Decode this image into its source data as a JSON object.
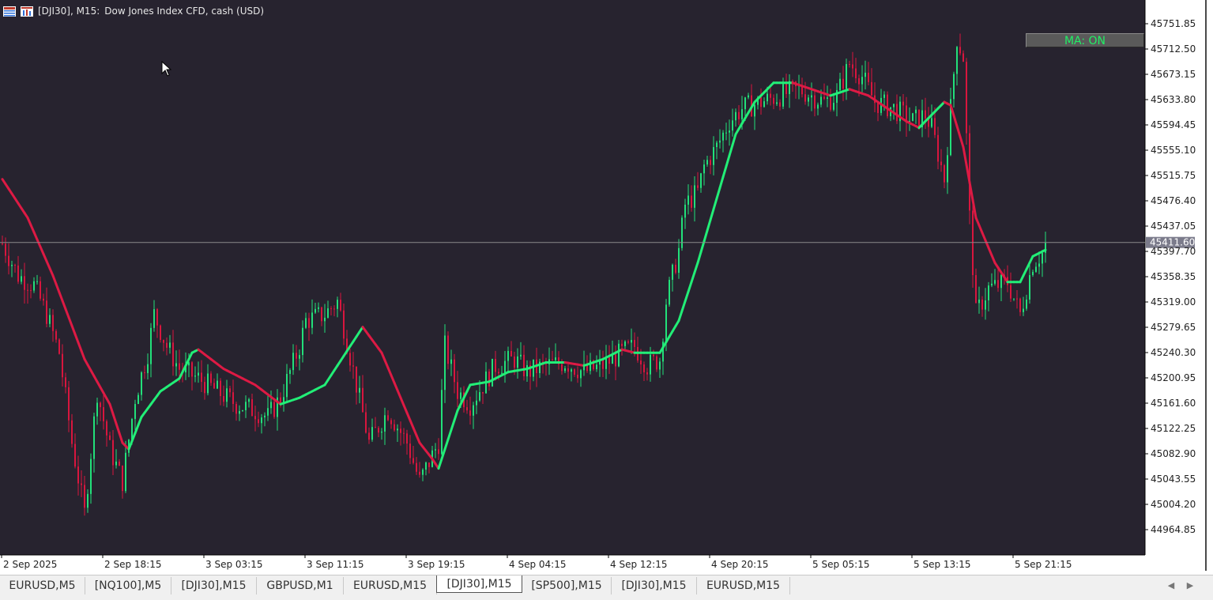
{
  "title": {
    "symbol": "[DJI30], M15:",
    "description": "Dow Jones Index CFD, cash (USD)"
  },
  "ma_button": {
    "label": "MA: ON"
  },
  "colors": {
    "background": "#27232f",
    "bull": "#22e07a",
    "bear": "#d8163e",
    "ma_up": "#22ee77",
    "ma_down": "#dd1a44",
    "price_line": "#8a8a8a",
    "price_badge": "#7b7b8b"
  },
  "tabs": [
    {
      "label": "EURUSD,M5",
      "active": false
    },
    {
      "label": "[NQ100],M5",
      "active": false
    },
    {
      "label": "[DJI30],M15",
      "active": false
    },
    {
      "label": "GBPUSD,M1",
      "active": false
    },
    {
      "label": "EURUSD,M15",
      "active": false
    },
    {
      "label": "[DJI30],M15",
      "active": true
    },
    {
      "label": "[SP500],M15",
      "active": false
    },
    {
      "label": "[DJI30],M15",
      "active": false
    },
    {
      "label": "EURUSD,M15",
      "active": false
    }
  ],
  "nav": {
    "prev_icon": "chevron-left-icon",
    "next_icon": "chevron-right-icon"
  },
  "chart_data": {
    "type": "candlestick",
    "symbol": "[DJI30]",
    "timeframe": "M15",
    "ylim": [
      44930,
      45780
    ],
    "y_ticks": [
      45751.85,
      45712.5,
      45673.15,
      45633.8,
      45594.45,
      45555.1,
      45515.75,
      45476.4,
      45437.05,
      45397.7,
      45358.35,
      45319.0,
      45279.65,
      45240.3,
      45200.95,
      45161.6,
      45122.25,
      45082.9,
      45043.55,
      45004.2,
      44964.85
    ],
    "y_tick_labels": [
      "45751.85",
      "45712.50",
      "45673.15",
      "45633.80",
      "45594.45",
      "45555.10",
      "45515.75",
      "45476.40",
      "45437.05",
      "45397.70",
      "45358.35",
      "45319.00",
      "45279.65",
      "45240.30",
      "45200.95",
      "45161.60",
      "45122.25",
      "45082.90",
      "45043.55",
      "45004.20",
      "44964.85"
    ],
    "x_tick_labels": [
      "2 Sep 2025",
      "2 Sep 18:15",
      "3 Sep 03:15",
      "3 Sep 11:15",
      "3 Sep 19:15",
      "4 Sep 04:15",
      "4 Sep 12:15",
      "4 Sep 20:15",
      "5 Sep 05:15",
      "5 Sep 13:15",
      "5 Sep 21:15"
    ],
    "current_price": 45411.6,
    "current_price_label": "45411.60",
    "bars_per_x_tick": 32,
    "price_path": [
      [
        0,
        45410
      ],
      [
        5,
        45360
      ],
      [
        10,
        45345
      ],
      [
        14,
        45300
      ],
      [
        18,
        45240
      ],
      [
        22,
        45100
      ],
      [
        26,
        44990
      ],
      [
        30,
        45180
      ],
      [
        34,
        45090
      ],
      [
        38,
        45040
      ],
      [
        42,
        45170
      ],
      [
        46,
        45240
      ],
      [
        48,
        45300
      ],
      [
        52,
        45250
      ],
      [
        56,
        45215
      ],
      [
        62,
        45200
      ],
      [
        68,
        45180
      ],
      [
        74,
        45160
      ],
      [
        80,
        45150
      ],
      [
        84,
        45140
      ],
      [
        88,
        45170
      ],
      [
        94,
        45250
      ],
      [
        96,
        45290
      ],
      [
        102,
        45300
      ],
      [
        106,
        45320
      ],
      [
        108,
        45280
      ],
      [
        112,
        45190
      ],
      [
        116,
        45100
      ],
      [
        122,
        45150
      ],
      [
        128,
        45100
      ],
      [
        132,
        45040
      ],
      [
        134,
        45060
      ],
      [
        138,
        45100
      ],
      [
        140,
        45250
      ],
      [
        144,
        45180
      ],
      [
        148,
        45160
      ],
      [
        152,
        45190
      ],
      [
        156,
        45220
      ],
      [
        162,
        45230
      ],
      [
        166,
        45210
      ],
      [
        172,
        45220
      ],
      [
        178,
        45225
      ],
      [
        184,
        45210
      ],
      [
        190,
        45220
      ],
      [
        196,
        45240
      ],
      [
        200,
        45250
      ],
      [
        204,
        45220
      ],
      [
        208,
        45230
      ],
      [
        210,
        45320
      ],
      [
        214,
        45400
      ],
      [
        216,
        45470
      ],
      [
        220,
        45490
      ],
      [
        222,
        45530
      ],
      [
        226,
        45560
      ],
      [
        230,
        45600
      ],
      [
        234,
        45620
      ],
      [
        240,
        45630
      ],
      [
        246,
        45640
      ],
      [
        252,
        45650
      ],
      [
        256,
        45640
      ],
      [
        260,
        45630
      ],
      [
        264,
        45640
      ],
      [
        268,
        45690
      ],
      [
        272,
        45670
      ],
      [
        276,
        45630
      ],
      [
        282,
        45620
      ],
      [
        288,
        45600
      ],
      [
        292,
        45610
      ],
      [
        294,
        45590
      ],
      [
        298,
        45510
      ],
      [
        300,
        45620
      ],
      [
        302,
        45730
      ],
      [
        304,
        45700
      ],
      [
        306,
        45450
      ],
      [
        308,
        45300
      ],
      [
        312,
        45340
      ],
      [
        318,
        45350
      ],
      [
        322,
        45300
      ],
      [
        326,
        45380
      ],
      [
        330,
        45400
      ]
    ],
    "ma_path": [
      [
        0,
        45510
      ],
      [
        8,
        45450
      ],
      [
        16,
        45360
      ],
      [
        26,
        45230
      ],
      [
        34,
        45160
      ],
      [
        38,
        45100
      ],
      [
        40,
        45090
      ],
      [
        44,
        45140
      ],
      [
        50,
        45180
      ],
      [
        56,
        45200
      ],
      [
        60,
        45240
      ],
      [
        62,
        45245
      ],
      [
        70,
        45215
      ],
      [
        80,
        45190
      ],
      [
        88,
        45160
      ],
      [
        94,
        45170
      ],
      [
        102,
        45190
      ],
      [
        110,
        45250
      ],
      [
        114,
        45280
      ],
      [
        120,
        45240
      ],
      [
        126,
        45170
      ],
      [
        132,
        45100
      ],
      [
        136,
        45075
      ],
      [
        138,
        45060
      ],
      [
        144,
        45150
      ],
      [
        148,
        45190
      ],
      [
        154,
        45195
      ],
      [
        160,
        45210
      ],
      [
        166,
        45215
      ],
      [
        172,
        45225
      ],
      [
        178,
        45225
      ],
      [
        184,
        45220
      ],
      [
        190,
        45230
      ],
      [
        196,
        45245
      ],
      [
        200,
        45240
      ],
      [
        208,
        45240
      ],
      [
        214,
        45290
      ],
      [
        220,
        45380
      ],
      [
        226,
        45480
      ],
      [
        232,
        45580
      ],
      [
        238,
        45630
      ],
      [
        244,
        45660
      ],
      [
        250,
        45660
      ],
      [
        256,
        45650
      ],
      [
        262,
        45640
      ],
      [
        268,
        45650
      ],
      [
        274,
        45640
      ],
      [
        280,
        45620
      ],
      [
        286,
        45600
      ],
      [
        290,
        45590
      ],
      [
        294,
        45610
      ],
      [
        298,
        45630
      ],
      [
        300,
        45625
      ],
      [
        304,
        45560
      ],
      [
        308,
        45450
      ],
      [
        314,
        45380
      ],
      [
        318,
        45350
      ],
      [
        322,
        45350
      ],
      [
        326,
        45390
      ],
      [
        330,
        45400
      ]
    ]
  }
}
